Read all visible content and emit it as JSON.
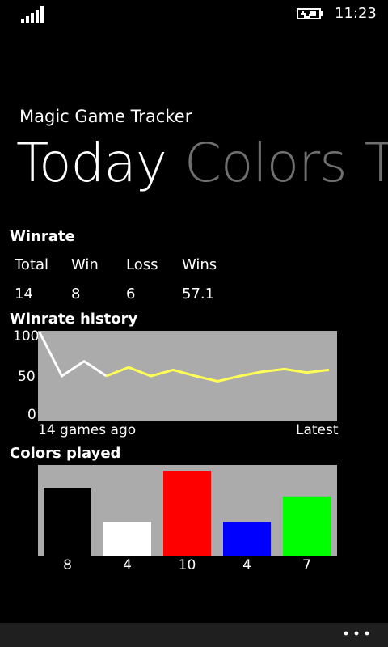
{
  "status": {
    "time": "11:23",
    "icons": [
      "signal-icon",
      "battery-charging-icon"
    ]
  },
  "app": {
    "title": "Magic Game Tracker"
  },
  "pivot": {
    "tabs": [
      "Today",
      "Colors",
      "T"
    ]
  },
  "winrate": {
    "heading": "Winrate",
    "headers": [
      "Total",
      "Win",
      "Loss",
      "Wins"
    ],
    "values": [
      "14",
      "8",
      "6",
      "57.1"
    ]
  },
  "history": {
    "heading": "Winrate history",
    "y_ticks": [
      "100",
      "50",
      "0"
    ],
    "x_start_label": "14 games ago",
    "x_end_label": "Latest",
    "bg_color": "#ABABAB"
  },
  "colors": {
    "heading": "Colors played",
    "bg_color": "#ABABAB"
  },
  "appbar": {
    "more_icon": "ellipsis-icon"
  },
  "chart_data": [
    {
      "type": "line",
      "title": "Winrate history",
      "xlabel": "",
      "ylabel": "",
      "ylim": [
        0,
        100
      ],
      "x": [
        1,
        2,
        3,
        4,
        5,
        6,
        7,
        8,
        9,
        10,
        11,
        12,
        13,
        14
      ],
      "series": [
        {
          "color": "#FFFF55",
          "values": [
            100,
            50,
            67,
            50,
            60,
            50,
            57,
            50,
            44,
            50,
            55,
            58,
            54,
            57.1
          ]
        }
      ]
    },
    {
      "type": "bar",
      "title": "Colors played",
      "categories": [
        "black",
        "white",
        "red",
        "blue",
        "green"
      ],
      "values": [
        8,
        4,
        10,
        4,
        7
      ],
      "colors": [
        "#000000",
        "#FFFFFF",
        "#FF0000",
        "#0000FF",
        "#00FF00"
      ],
      "ylim": [
        0,
        10
      ]
    }
  ]
}
